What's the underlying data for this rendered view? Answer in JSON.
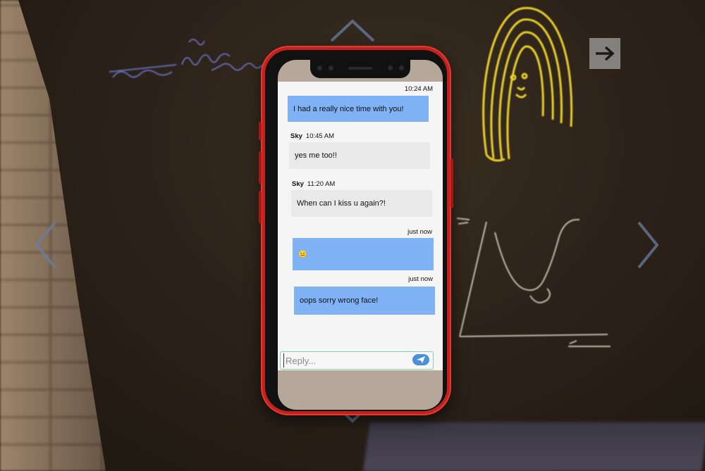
{
  "nav": {
    "up_icon": "chevron-up-icon",
    "down_icon": "chevron-down-icon",
    "left_icon": "chevron-left-icon",
    "right_icon": "chevron-right-icon",
    "next_icon": "arrow-right-icon"
  },
  "phone": {
    "color": "#c4201c",
    "messages": [
      {
        "direction": "outgoing",
        "sender": "",
        "time": "10:24 AM",
        "text": "I had a really nice time with you!"
      },
      {
        "direction": "incoming",
        "sender": "Sky",
        "time": "10:45 AM",
        "text": "yes me too!!"
      },
      {
        "direction": "incoming",
        "sender": "Sky",
        "time": "11:20 AM",
        "text": "When can I kiss u again?!"
      },
      {
        "direction": "outgoing",
        "sender": "",
        "time": "just now",
        "text": "😐"
      },
      {
        "direction": "outgoing",
        "sender": "",
        "time": "just now",
        "text": "oops sorry wrong face!"
      }
    ],
    "reply": {
      "placeholder": "Reply...",
      "value": "",
      "send_icon": "send-icon"
    }
  },
  "colors": {
    "outgoing_bubble": "#7fb3f5",
    "incoming_bubble": "#e9e9e9",
    "send_button": "#4a8fdc"
  }
}
